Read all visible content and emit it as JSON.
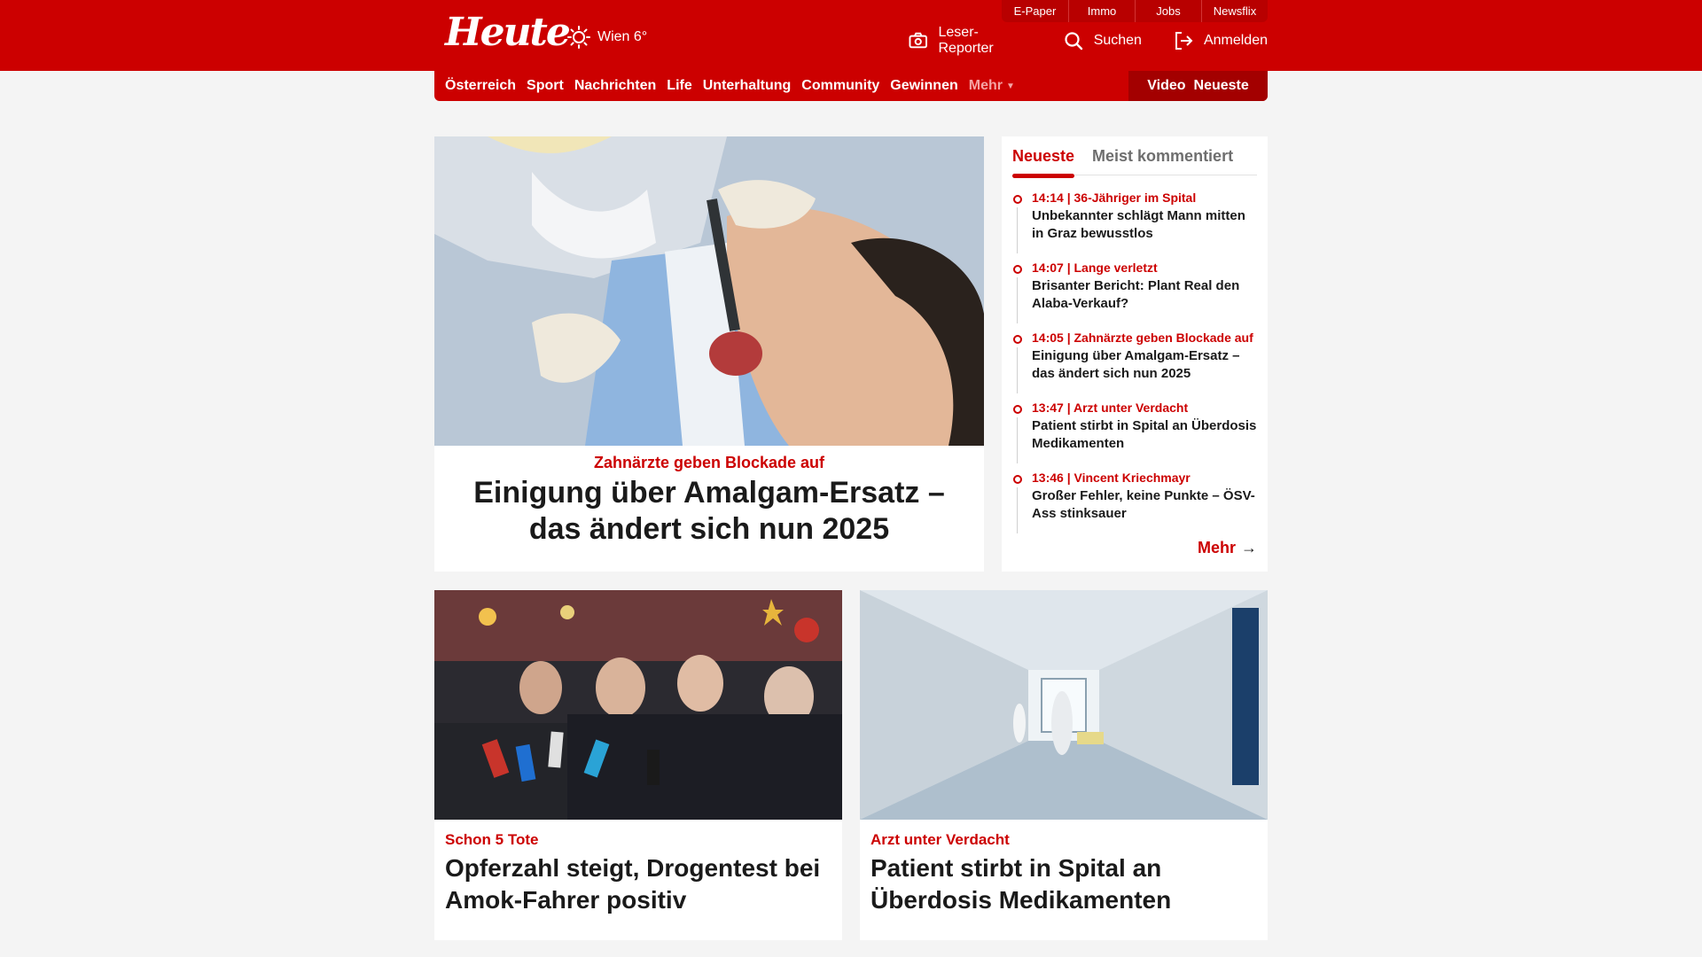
{
  "header": {
    "logo": "Heute",
    "weather": {
      "city_temp": "Wien 6°",
      "icon": "sun-icon"
    },
    "top_links": [
      "E-Paper",
      "Immo",
      "Jobs",
      "Newsflix"
    ],
    "actions": [
      {
        "label": "Leser-Reporter",
        "icon": "camera-icon"
      },
      {
        "label": "Suchen",
        "icon": "search-icon"
      },
      {
        "label": "Anmelden",
        "icon": "login-icon"
      }
    ],
    "accent": "#cc0000"
  },
  "nav": {
    "items": [
      "Österreich",
      "Sport",
      "Nachrichten",
      "Life",
      "Unterhaltung",
      "Community",
      "Gewinnen"
    ],
    "more": "Mehr",
    "right": [
      "Video",
      "Neueste"
    ]
  },
  "hero": {
    "kicker": "Zahnärzte geben Blockade auf",
    "title": "Einigung über Amalgam-Ersatz – das ändert sich nun 2025"
  },
  "sidebar": {
    "tabs": [
      "Neueste",
      "Meist kommentiert"
    ],
    "items": [
      {
        "meta": "14:14 | 36-Jähriger im Spital",
        "title": "Unbekannter schlägt Mann mitten in Graz bewusstlos"
      },
      {
        "meta": "14:07 | Lange verletzt",
        "title": "Brisanter Bericht: Plant Real den Alaba-Verkauf?"
      },
      {
        "meta": "14:05 | Zahnärzte geben Blockade auf",
        "title": "Einigung über Amalgam-Ersatz – das ändert sich nun 2025"
      },
      {
        "meta": "13:47 | Arzt unter Verdacht",
        "title": "Patient stirbt in Spital an Überdosis Medikamenten"
      },
      {
        "meta": "13:46 | Vincent Kriechmayr",
        "title": "Großer Fehler, keine Punkte – ÖSV-Ass stinksauer"
      }
    ],
    "more": "Mehr"
  },
  "cards": [
    {
      "kicker": "Schon 5 Tote",
      "title": "Opferzahl steigt, Drogentest bei Amok-Fahrer positiv"
    },
    {
      "kicker": "Arzt unter Verdacht",
      "title": "Patient stirbt in Spital an Überdosis Medikamenten"
    }
  ]
}
